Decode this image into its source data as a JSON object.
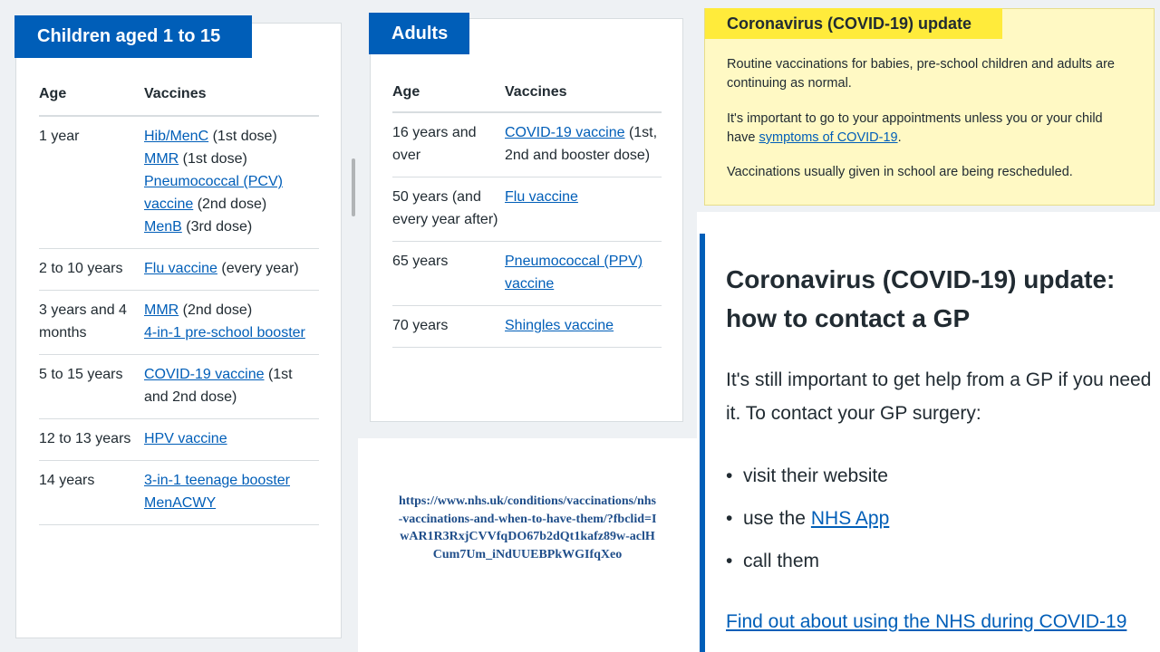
{
  "children": {
    "tag": "Children aged 1 to 15",
    "headers": {
      "age": "Age",
      "vaccines": "Vaccines"
    },
    "rows": [
      {
        "age": "1 year",
        "items": [
          {
            "link": "Hib/MenC",
            "rest": " (1st dose)"
          },
          {
            "link": "MMR",
            "rest": " (1st dose)"
          },
          {
            "link": "Pneumococcal (PCV) vaccine",
            "rest": " (2nd dose)"
          },
          {
            "link": "MenB",
            "rest": " (3rd dose)"
          }
        ]
      },
      {
        "age": "2 to 10 years",
        "items": [
          {
            "link": "Flu vaccine",
            "rest": " (every year)"
          }
        ]
      },
      {
        "age": "3 years and 4 months",
        "items": [
          {
            "link": "MMR",
            "rest": " (2nd dose)"
          },
          {
            "link": "4-in-1 pre-school booster",
            "rest": ""
          }
        ]
      },
      {
        "age": "5 to 15 years",
        "items": [
          {
            "link": "COVID-19 vaccine",
            "rest": " (1st and 2nd dose)"
          }
        ]
      },
      {
        "age": "12 to 13 years",
        "items": [
          {
            "link": "HPV vaccine",
            "rest": ""
          }
        ]
      },
      {
        "age": "14 years",
        "items": [
          {
            "link": "3-in-1 teenage booster",
            "rest": ""
          },
          {
            "link": "MenACWY",
            "rest": ""
          }
        ]
      }
    ]
  },
  "adults": {
    "tag": "Adults",
    "headers": {
      "age": "Age",
      "vaccines": "Vaccines"
    },
    "rows": [
      {
        "age": "16 years and over",
        "items": [
          {
            "link": "COVID-19 vaccine",
            "rest": " (1st, 2nd and booster dose)"
          }
        ]
      },
      {
        "age": "50 years (and every year after)",
        "items": [
          {
            "link": "Flu vaccine",
            "rest": ""
          }
        ]
      },
      {
        "age": "65 years",
        "items": [
          {
            "link": "Pneumococcal (PPV) vaccine",
            "rest": ""
          }
        ]
      },
      {
        "age": "70 years",
        "items": [
          {
            "link": "Shingles vaccine",
            "rest": ""
          }
        ]
      }
    ]
  },
  "source_url": "https://www.nhs.uk/conditions/vaccinations/nhs-vaccinations-and-when-to-have-them/?fbclid=IwAR1R3RxjCVVfqDO67b2dQt1kafz89w-aclHCum7Um_iNdUUEBPkWGIfqXeo",
  "covid_update": {
    "tag": "Coronavirus (COVID-19) update",
    "p1": "Routine vaccinations for babies, pre-school children and adults are continuing as normal.",
    "p2_before": "It's important to go to your appointments unless you or your child have ",
    "p2_link": "symptoms of COVID-19",
    "p2_after": ".",
    "p3": "Vaccinations usually given in school are being rescheduled."
  },
  "gp": {
    "title": "Coronavirus (COVID-19) update: how to contact a GP",
    "intro": "It's still important to get help from a GP if you need it. To contact your GP surgery:",
    "bullet": "•",
    "list": [
      {
        "before": "visit their website",
        "link": ""
      },
      {
        "before": "use the ",
        "link": "NHS App"
      },
      {
        "before": "call them",
        "link": ""
      }
    ],
    "link": "Find out about using the NHS during COVID-19"
  },
  "colors": {
    "nhs_blue": "#005eb8",
    "yellow_tag": "#ffeb3b",
    "yellow_bg": "#fff9c4"
  }
}
